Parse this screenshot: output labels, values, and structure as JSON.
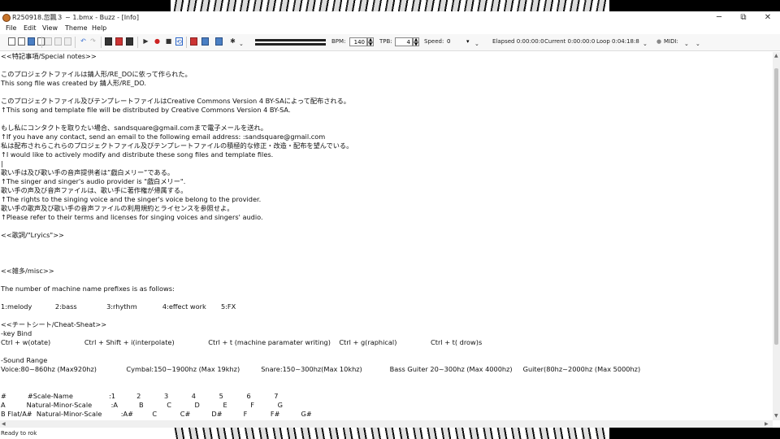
{
  "window": {
    "title": "R250918.忽飄３ ~ 1.bmx - Buzz - [Info]",
    "controls": {
      "minimize": "─",
      "maximize": "⧉",
      "close": "✕"
    }
  },
  "menu": [
    "File",
    "Edit",
    "View",
    "Theme",
    "Help"
  ],
  "toolbar": {
    "bpm_label": "BPM:",
    "bpm_value": "140",
    "tpb_label": "TPB:",
    "tpb_value": "4",
    "speed_label": "Speed:",
    "speed_value": "0",
    "elapsed": "Elapsed 0:00:00:0",
    "current": "Current 0:00:00:0",
    "loop": "Loop 0:04:18:8",
    "midi_label": "MIDI:",
    "chevron": "⌄",
    "spin_up": "▲",
    "spin_down": "▼",
    "speed_caret": "▾",
    "midi_dot": "●"
  },
  "toolbar_icons": [
    "new-file-icon",
    "open-file-icon",
    "save-icon",
    "save-as-icon",
    "cut-icon",
    "copy-icon",
    "paste-icon",
    "undo-icon",
    "redo-icon",
    "machine-view-icon",
    "pattern-view-icon",
    "sequence-view-icon",
    "play-icon",
    "record-icon",
    "stop-icon",
    "loop-icon",
    "mixer-icon",
    "wavetable-icon",
    "analyzer-icon",
    "settings-icon"
  ],
  "info_lines": [
    "<<特記事項/Special notes>>",
    "",
    "このプロジェクトファイルは錆人形/RE_DOに依って作られた。",
    "This song file was created by 錆人形/RE_DO.",
    "",
    "このプロジェクトファイル及びテンプレートファイルはCreative Commons Version 4 BY-SAによって配布される。",
    "↑This song and template file will be distributed by Creative Commons Version 4 BY-SA.",
    "",
    "もし私にコンタクトを取りたい場合、sandsquare@gmail.comまで電子メールを送れ。",
    "↑If you have any contact, send an email to the following email address: :sandsquare@gmail.com",
    "私は配布されらこれらのプロジェクトファイル及びテンプレートファイルの積極的な修正・改造・配布を望んでいる。",
    "↑I would like to actively modify and distribute these song files and template files.",
    "|",
    "歌い手は及び歌い手の音声提供者は”戯白メリー”である。",
    "↑The singer and singer's audio provider is \"戯白メリー\".",
    "歌い手の声及び音声ファイルは、歌い手に著作権が帰属する。",
    "↑The rights to the singing voice and the singer's voice belong to the provider.",
    "歌い手の歌声及び歌い手の音声ファイルの利用規約とライセンスを参照せよ。",
    "↑Please refer to their terms and licenses for singing voices and singers' audio.",
    "",
    "<<歌詞/\"Lryics\">>",
    "",
    "",
    "",
    "<<雑多/misc>>",
    "",
    "The number of machine name prefixes is as follows:",
    "",
    "1:melody           2:bass              3:rhythm            4:effect work       5:FX",
    "",
    "<<チートシート/Cheat-Sheat>>",
    "-key Bind",
    "Ctrl + w(otate)                Ctrl + Shift + i(interpolate)                Ctrl + t (machine paramater writing)    Ctrl + g(raphical)                Ctrl + t( drow)s",
    "",
    "-Sound Range",
    "Voice:80~860hz (Max920hz)              Cymbal:150~1900hz (Max 19khz)          Snare:150~300hz(Max 10khz)             Bass Guiter 20~300hz (Max 4000hz)     Guiter(80hz~2000hz (Max 5000hz)",
    "",
    "",
    "#          #Scale-Name                 :1          2           3           4           5           6           7",
    "A          Natural-Minor-Scale         :A          B           C           D           E           F           G",
    "B Flat/A#  Natural-Minor-Scale         :A#         C           C#          D#          F           F#          G#"
  ],
  "scrollbars": {
    "up": "▲",
    "down": "▼",
    "left": "◀",
    "right": "▶"
  },
  "status": {
    "text": "Ready to rok"
  }
}
